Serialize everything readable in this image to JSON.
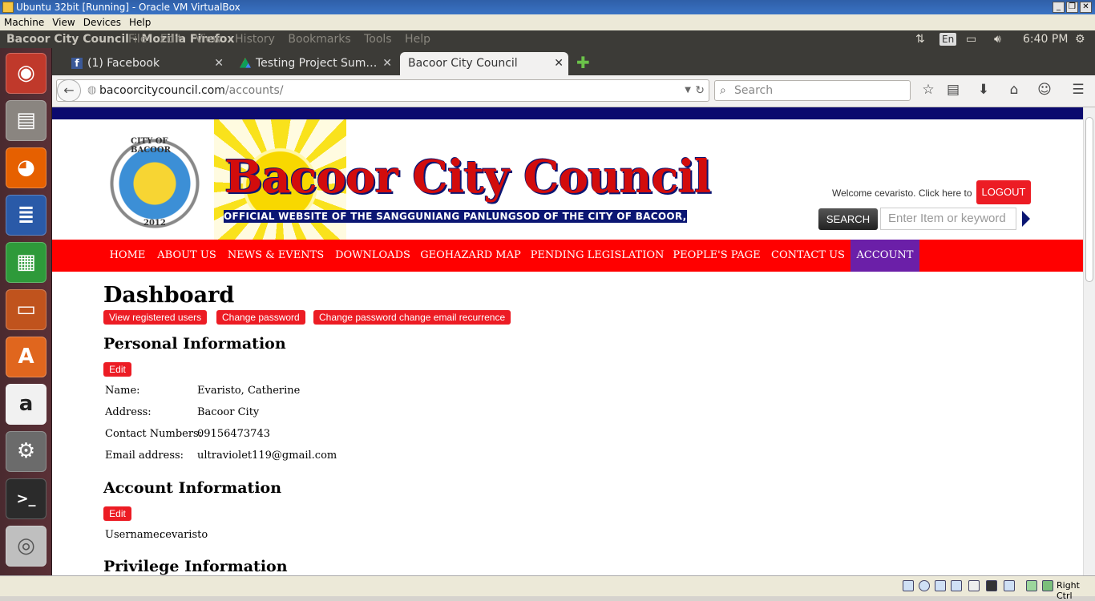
{
  "vbox": {
    "title": "Ubuntu 32bit [Running] - Oracle VM VirtualBox",
    "menu": [
      "Machine",
      "View",
      "Devices",
      "Help"
    ],
    "host_key": "Right Ctrl"
  },
  "ubuntu_panel": {
    "app_title": "Bacoor City Council - Mozilla Firefox",
    "ff_menu": [
      "File",
      "Edit",
      "View",
      "History",
      "Bookmarks",
      "Tools",
      "Help"
    ],
    "keyboard_layout": "En",
    "clock": "6:40 PM"
  },
  "launcher": {
    "icons": [
      "ubuntu-dash-icon",
      "files-icon",
      "firefox-icon",
      "writer-icon",
      "calc-icon",
      "impress-icon",
      "software-center-icon",
      "amazon-icon",
      "system-settings-icon",
      "terminal-icon",
      "dvd-icon"
    ]
  },
  "browser": {
    "tabs": [
      {
        "label": "(1) Facebook",
        "icon": "facebook-icon"
      },
      {
        "label": "Testing Project Sum…",
        "icon": "google-drive-icon"
      },
      {
        "label": "Bacoor City Council",
        "icon": ""
      }
    ],
    "new_tab_icon": "plus-icon",
    "url_domain": "bacoorcitycouncil.com",
    "url_path": "/accounts/",
    "search_placeholder": "Search"
  },
  "site": {
    "title": "Bacoor City Council",
    "subtitle": "OFFICIAL WEBSITE OF THE SANGGUNIANG PANLUNGSOD OF THE CITY OF BACOOR, CAVITE",
    "seal_text_top": "CITY OF BACOOR",
    "seal_year": "2012",
    "welcome": "Welcome cevaristo. Click here to",
    "logout": "LOGOUT",
    "search_button": "SEARCH",
    "search_placeholder": "Enter Item or keyword",
    "accent_red": "#ff0000",
    "accent_navy": "#0b1673",
    "active_nav_color": "#6b1fa8",
    "nav": [
      "HOME",
      "ABOUT US",
      "NEWS & EVENTS",
      "DOWNLOADS",
      "GEOHAZARD MAP",
      "PENDING LEGISLATION",
      "PEOPLE'S PAGE",
      "CONTACT US",
      "ACCOUNT"
    ],
    "active_nav": "ACCOUNT"
  },
  "dashboard": {
    "title": "Dashboard",
    "actions": [
      "View registered users",
      "Change password",
      "Change password change email recurrence"
    ],
    "personal": {
      "heading": "Personal Information",
      "edit": "Edit",
      "rows": [
        {
          "label": "Name:",
          "value": "Evaristo, Catherine"
        },
        {
          "label": "Address:",
          "value": "Bacoor City"
        },
        {
          "label": "Contact Numbers:",
          "value": "09156473743"
        },
        {
          "label": "Email address:",
          "value": "ultraviolet119@gmail.com"
        }
      ]
    },
    "account": {
      "heading": "Account Information",
      "edit": "Edit",
      "username_label": "Username:",
      "username_value": "cevaristo"
    },
    "privilege": {
      "heading": "Privilege Information"
    }
  }
}
